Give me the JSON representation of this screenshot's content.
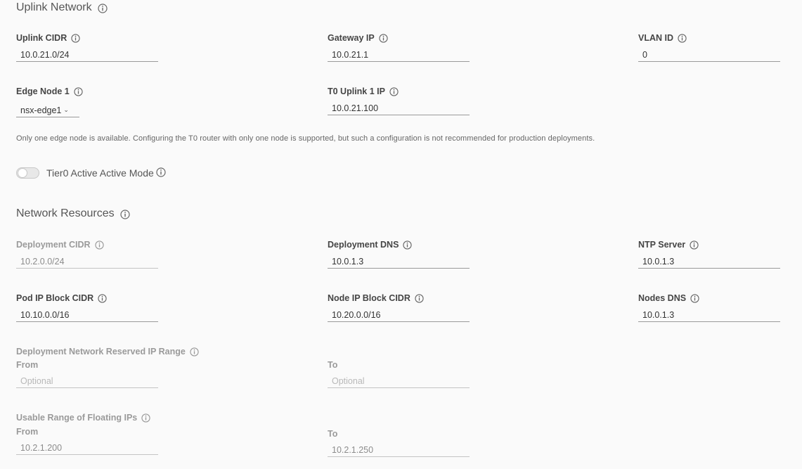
{
  "uplink": {
    "title": "Uplink Network",
    "uplink_cidr": {
      "label": "Uplink CIDR",
      "value": "10.0.21.0/24"
    },
    "gateway_ip": {
      "label": "Gateway IP",
      "value": "10.0.21.1"
    },
    "vlan_id": {
      "label": "VLAN ID",
      "value": "0"
    },
    "edge_node_1": {
      "label": "Edge Node 1",
      "value": "nsx-edge1"
    },
    "t0_uplink_1_ip": {
      "label": "T0 Uplink 1 IP",
      "value": "10.0.21.100"
    },
    "helper_text": "Only one edge node is available. Configuring the T0 router with only one node is supported, but such a configuration is not recommended for production deployments.",
    "tier0_toggle": {
      "label": "Tier0 Active Active Mode",
      "enabled": false
    }
  },
  "network_resources": {
    "title": "Network Resources",
    "deployment_cidr": {
      "label": "Deployment CIDR",
      "value": "10.2.0.0/24",
      "disabled": true
    },
    "deployment_dns": {
      "label": "Deployment DNS",
      "value": "10.0.1.3"
    },
    "ntp_server": {
      "label": "NTP Server",
      "value": "10.0.1.3"
    },
    "pod_ip_block_cidr": {
      "label": "Pod IP Block CIDR",
      "value": "10.10.0.0/16"
    },
    "node_ip_block_cidr": {
      "label": "Node IP Block CIDR",
      "value": "10.20.0.0/16"
    },
    "nodes_dns": {
      "label": "Nodes DNS",
      "value": "10.0.1.3"
    },
    "reserved_range": {
      "label": "Deployment Network Reserved IP Range",
      "from_label": "From",
      "from_placeholder": "Optional",
      "from_value": "",
      "to_label": "To",
      "to_placeholder": "Optional",
      "to_value": ""
    },
    "floating_range": {
      "label": "Usable Range of Floating IPs",
      "from_label": "From",
      "from_value": "10.2.1.200",
      "to_label": "To",
      "to_value": "10.2.1.250"
    }
  }
}
